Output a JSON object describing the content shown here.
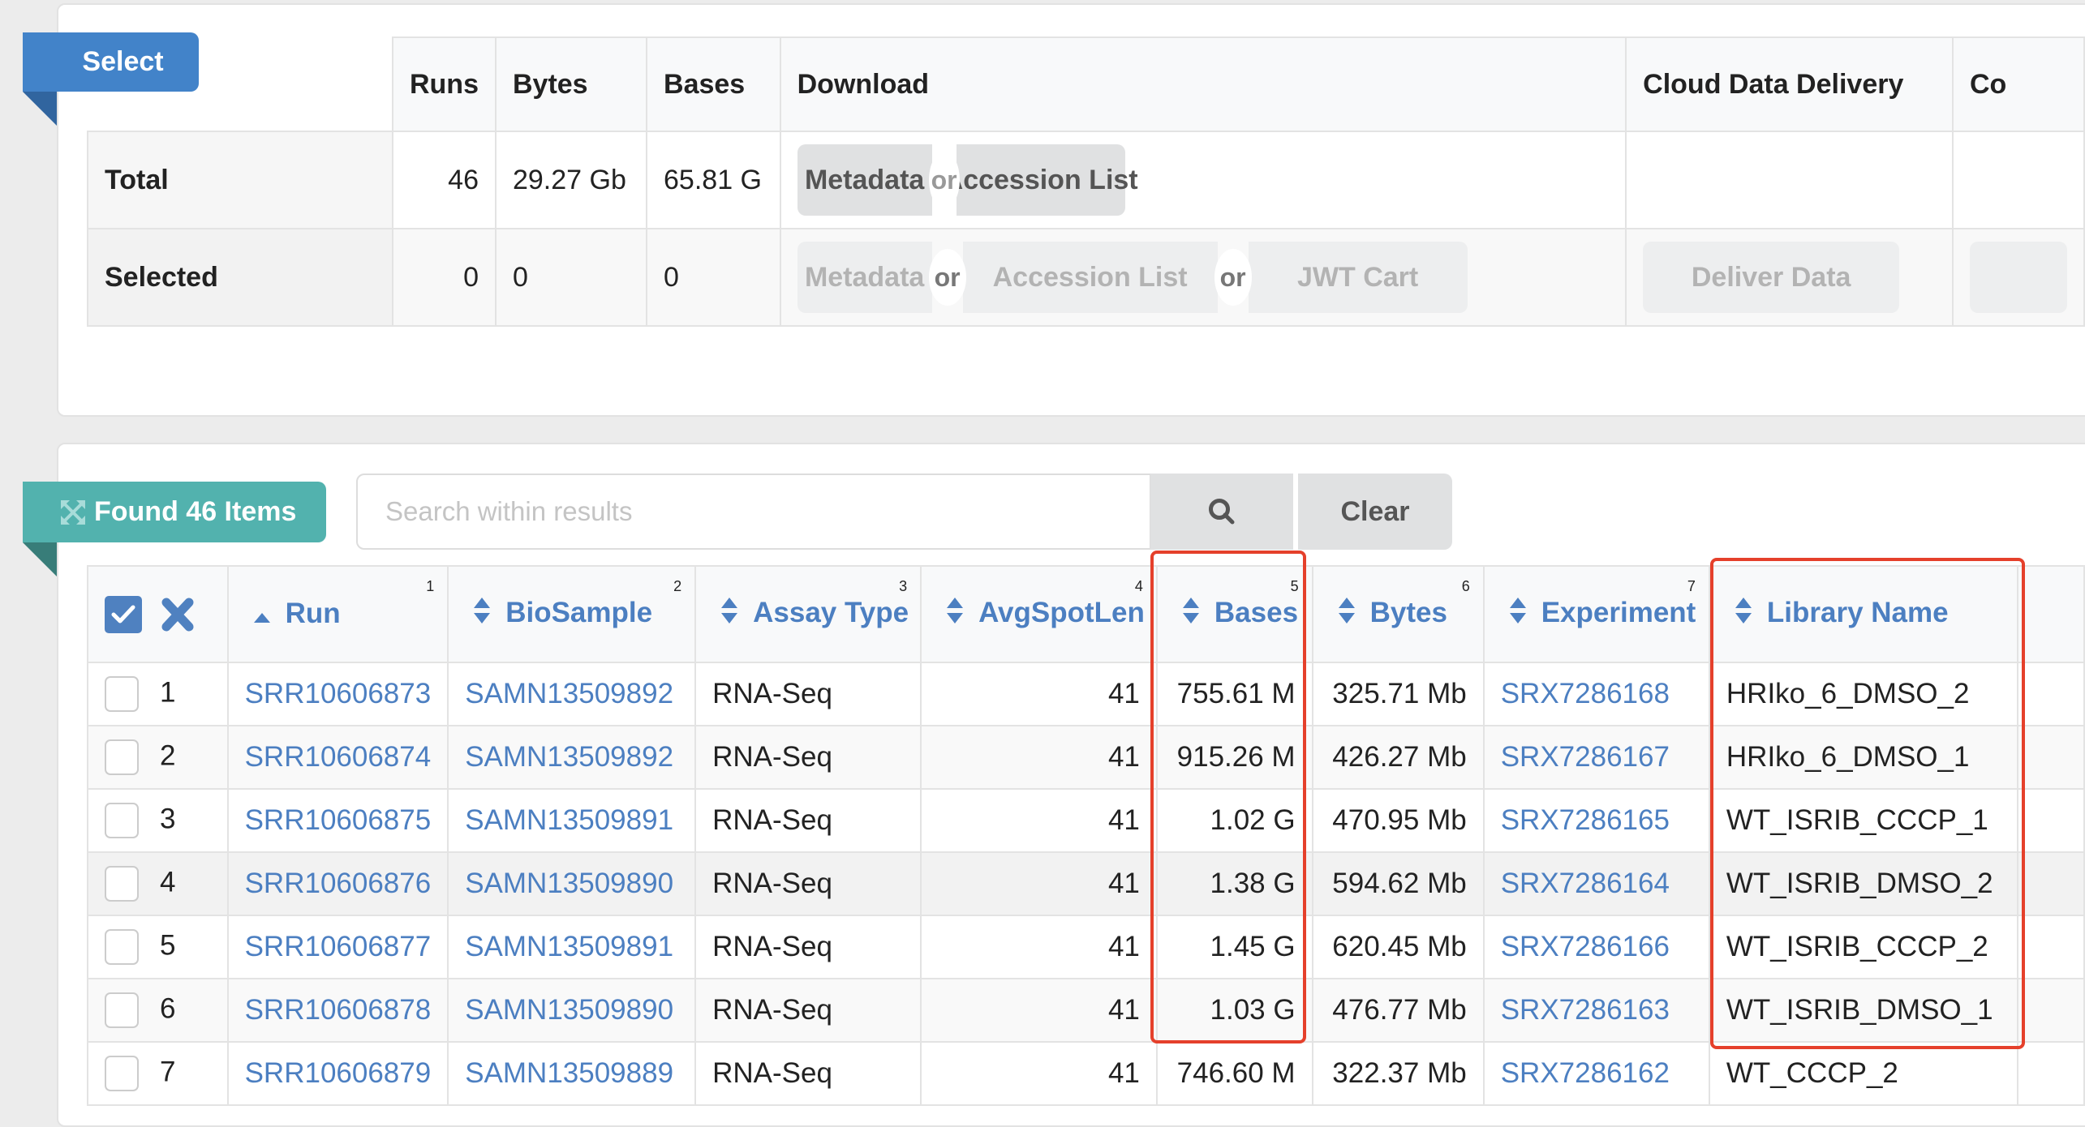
{
  "select_panel": {
    "tab_label": "Select",
    "columns": [
      "Runs",
      "Bytes",
      "Bases",
      "Download",
      "Cloud Data Delivery",
      "Co"
    ],
    "rows": [
      {
        "label": "Total",
        "runs": "46",
        "bytes": "29.27 Gb",
        "bases": "65.81 G",
        "download": {
          "metadata": "Metadata",
          "or1": "or",
          "accession": "Accession List"
        }
      },
      {
        "label": "Selected",
        "runs": "0",
        "bytes": "0",
        "bases": "0",
        "download": {
          "metadata": "Metadata",
          "or1": "or",
          "accession": "Accession List",
          "or2": "or",
          "jwt": "JWT Cart"
        },
        "cloud": {
          "deliver": "Deliver Data"
        }
      }
    ]
  },
  "results_panel": {
    "tab_label": "Found 46 Items",
    "tab_icon": "expand-arrows-icon",
    "search": {
      "placeholder": "Search within results",
      "value": ""
    },
    "search_button_icon": "search-icon",
    "clear_label": "Clear",
    "columns": [
      {
        "label": "Run",
        "order": "1",
        "sort": "ascending"
      },
      {
        "label": "BioSample",
        "order": "2",
        "sort": "none"
      },
      {
        "label": "Assay Type",
        "order": "3",
        "sort": "none"
      },
      {
        "label": "AvgSpotLen",
        "order": "4",
        "sort": "none"
      },
      {
        "label": "Bases",
        "order": "5",
        "sort": "none"
      },
      {
        "label": "Bytes",
        "order": "6",
        "sort": "none"
      },
      {
        "label": "Experiment",
        "order": "7",
        "sort": "none"
      },
      {
        "label": "Library Name",
        "order": "",
        "sort": "none"
      }
    ],
    "rows": [
      {
        "n": "1",
        "run": "SRR10606873",
        "biosample": "SAMN13509892",
        "assay": "RNA-Seq",
        "avgspotlen": "41",
        "bases": "755.61 M",
        "bytes": "325.71 Mb",
        "experiment": "SRX7286168",
        "library": "HRIko_6_DMSO_2"
      },
      {
        "n": "2",
        "run": "SRR10606874",
        "biosample": "SAMN13509892",
        "assay": "RNA-Seq",
        "avgspotlen": "41",
        "bases": "915.26 M",
        "bytes": "426.27 Mb",
        "experiment": "SRX7286167",
        "library": "HRIko_6_DMSO_1"
      },
      {
        "n": "3",
        "run": "SRR10606875",
        "biosample": "SAMN13509891",
        "assay": "RNA-Seq",
        "avgspotlen": "41",
        "bases": "1.02 G",
        "bytes": "470.95 Mb",
        "experiment": "SRX7286165",
        "library": "WT_ISRIB_CCCP_1"
      },
      {
        "n": "4",
        "run": "SRR10606876",
        "biosample": "SAMN13509890",
        "assay": "RNA-Seq",
        "avgspotlen": "41",
        "bases": "1.38 G",
        "bytes": "594.62 Mb",
        "experiment": "SRX7286164",
        "library": "WT_ISRIB_DMSO_2"
      },
      {
        "n": "5",
        "run": "SRR10606877",
        "biosample": "SAMN13509891",
        "assay": "RNA-Seq",
        "avgspotlen": "41",
        "bases": "1.45 G",
        "bytes": "620.45 Mb",
        "experiment": "SRX7286166",
        "library": "WT_ISRIB_CCCP_2"
      },
      {
        "n": "6",
        "run": "SRR10606878",
        "biosample": "SAMN13509890",
        "assay": "RNA-Seq",
        "avgspotlen": "41",
        "bases": "1.03 G",
        "bytes": "476.77 Mb",
        "experiment": "SRX7286163",
        "library": "WT_ISRIB_DMSO_1"
      },
      {
        "n": "7",
        "run": "SRR10606879",
        "biosample": "SAMN13509889",
        "assay": "RNA-Seq",
        "avgspotlen": "41",
        "bases": "746.60 M",
        "bytes": "322.37 Mb",
        "experiment": "SRX7286162",
        "library": "WT_CCCP_2"
      }
    ]
  },
  "annotations": {
    "highlight_color": "#e5402b",
    "highlighted_columns": [
      "Bases",
      "Library Name"
    ]
  },
  "colors": {
    "select_tab": "#4283c9",
    "found_tab": "#52b2ae",
    "link": "#4c7fc1"
  }
}
